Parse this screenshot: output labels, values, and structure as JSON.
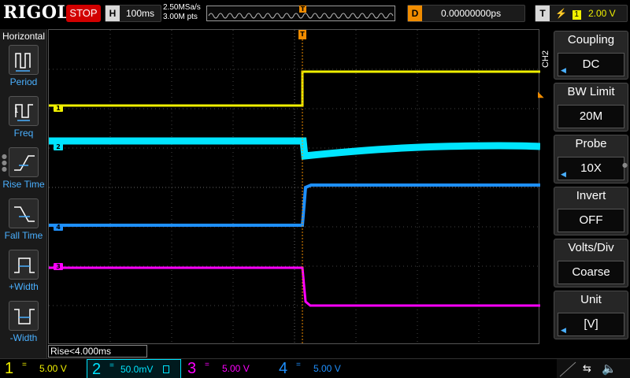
{
  "top": {
    "logo": "RIGOL",
    "run_state": "STOP",
    "timebase_key": "H",
    "timebase": "100ms",
    "sample_rate": "2.50MSa/s",
    "memory_depth": "3.00M pts",
    "delay_key": "D",
    "delay": "0.00000000ps",
    "trigger_key": "T",
    "trigger_source": "1",
    "trigger_level": "2.00 V"
  },
  "left_panel": {
    "title": "Horizontal",
    "items": [
      {
        "label": "Period",
        "icon": "period-icon"
      },
      {
        "label": "Freq",
        "icon": "freq-icon"
      },
      {
        "label": "Rise Time",
        "icon": "rise-time-icon"
      },
      {
        "label": "Fall Time",
        "icon": "fall-time-icon"
      },
      {
        "label": "+Width",
        "icon": "pos-width-icon"
      },
      {
        "label": "-Width",
        "icon": "neg-width-icon"
      }
    ]
  },
  "measurement_readout": "Rise<4.000ms",
  "channel_markers": [
    {
      "label": "1",
      "color": "#f0f000"
    },
    {
      "label": "2",
      "color": "#00e5ff"
    },
    {
      "label": "4",
      "color": "#1e90ff"
    },
    {
      "label": "3",
      "color": "#ff00ff"
    }
  ],
  "right_menu": {
    "channel_tab": "CH2",
    "groups": [
      {
        "title": "Coupling",
        "value": "DC"
      },
      {
        "title": "BW Limit",
        "value": "20M"
      },
      {
        "title": "Probe",
        "value": "10X"
      },
      {
        "title": "Invert",
        "value": "OFF"
      },
      {
        "title": "Volts/Div",
        "value": "Coarse"
      },
      {
        "title": "Unit",
        "value": "[V]"
      }
    ]
  },
  "bottom": {
    "channels": [
      {
        "num": "1",
        "coupling": "=",
        "scale": "5.00 V",
        "color": "#f0f000"
      },
      {
        "num": "2",
        "coupling": "=",
        "scale": "50.0mV",
        "color": "#00e5ff"
      },
      {
        "num": "3",
        "coupling": "=",
        "scale": "5.00 V",
        "color": "#ff00ff"
      },
      {
        "num": "4",
        "coupling": "=",
        "scale": "5.00 V",
        "color": "#1e90ff"
      }
    ]
  },
  "colors": {
    "ch1": "#f0f000",
    "ch2": "#00e5ff",
    "ch3": "#ff00ff",
    "ch4": "#1e90ff",
    "trigger": "#f08c00",
    "accent": "#4ab0ff",
    "stop": "#d20000"
  }
}
